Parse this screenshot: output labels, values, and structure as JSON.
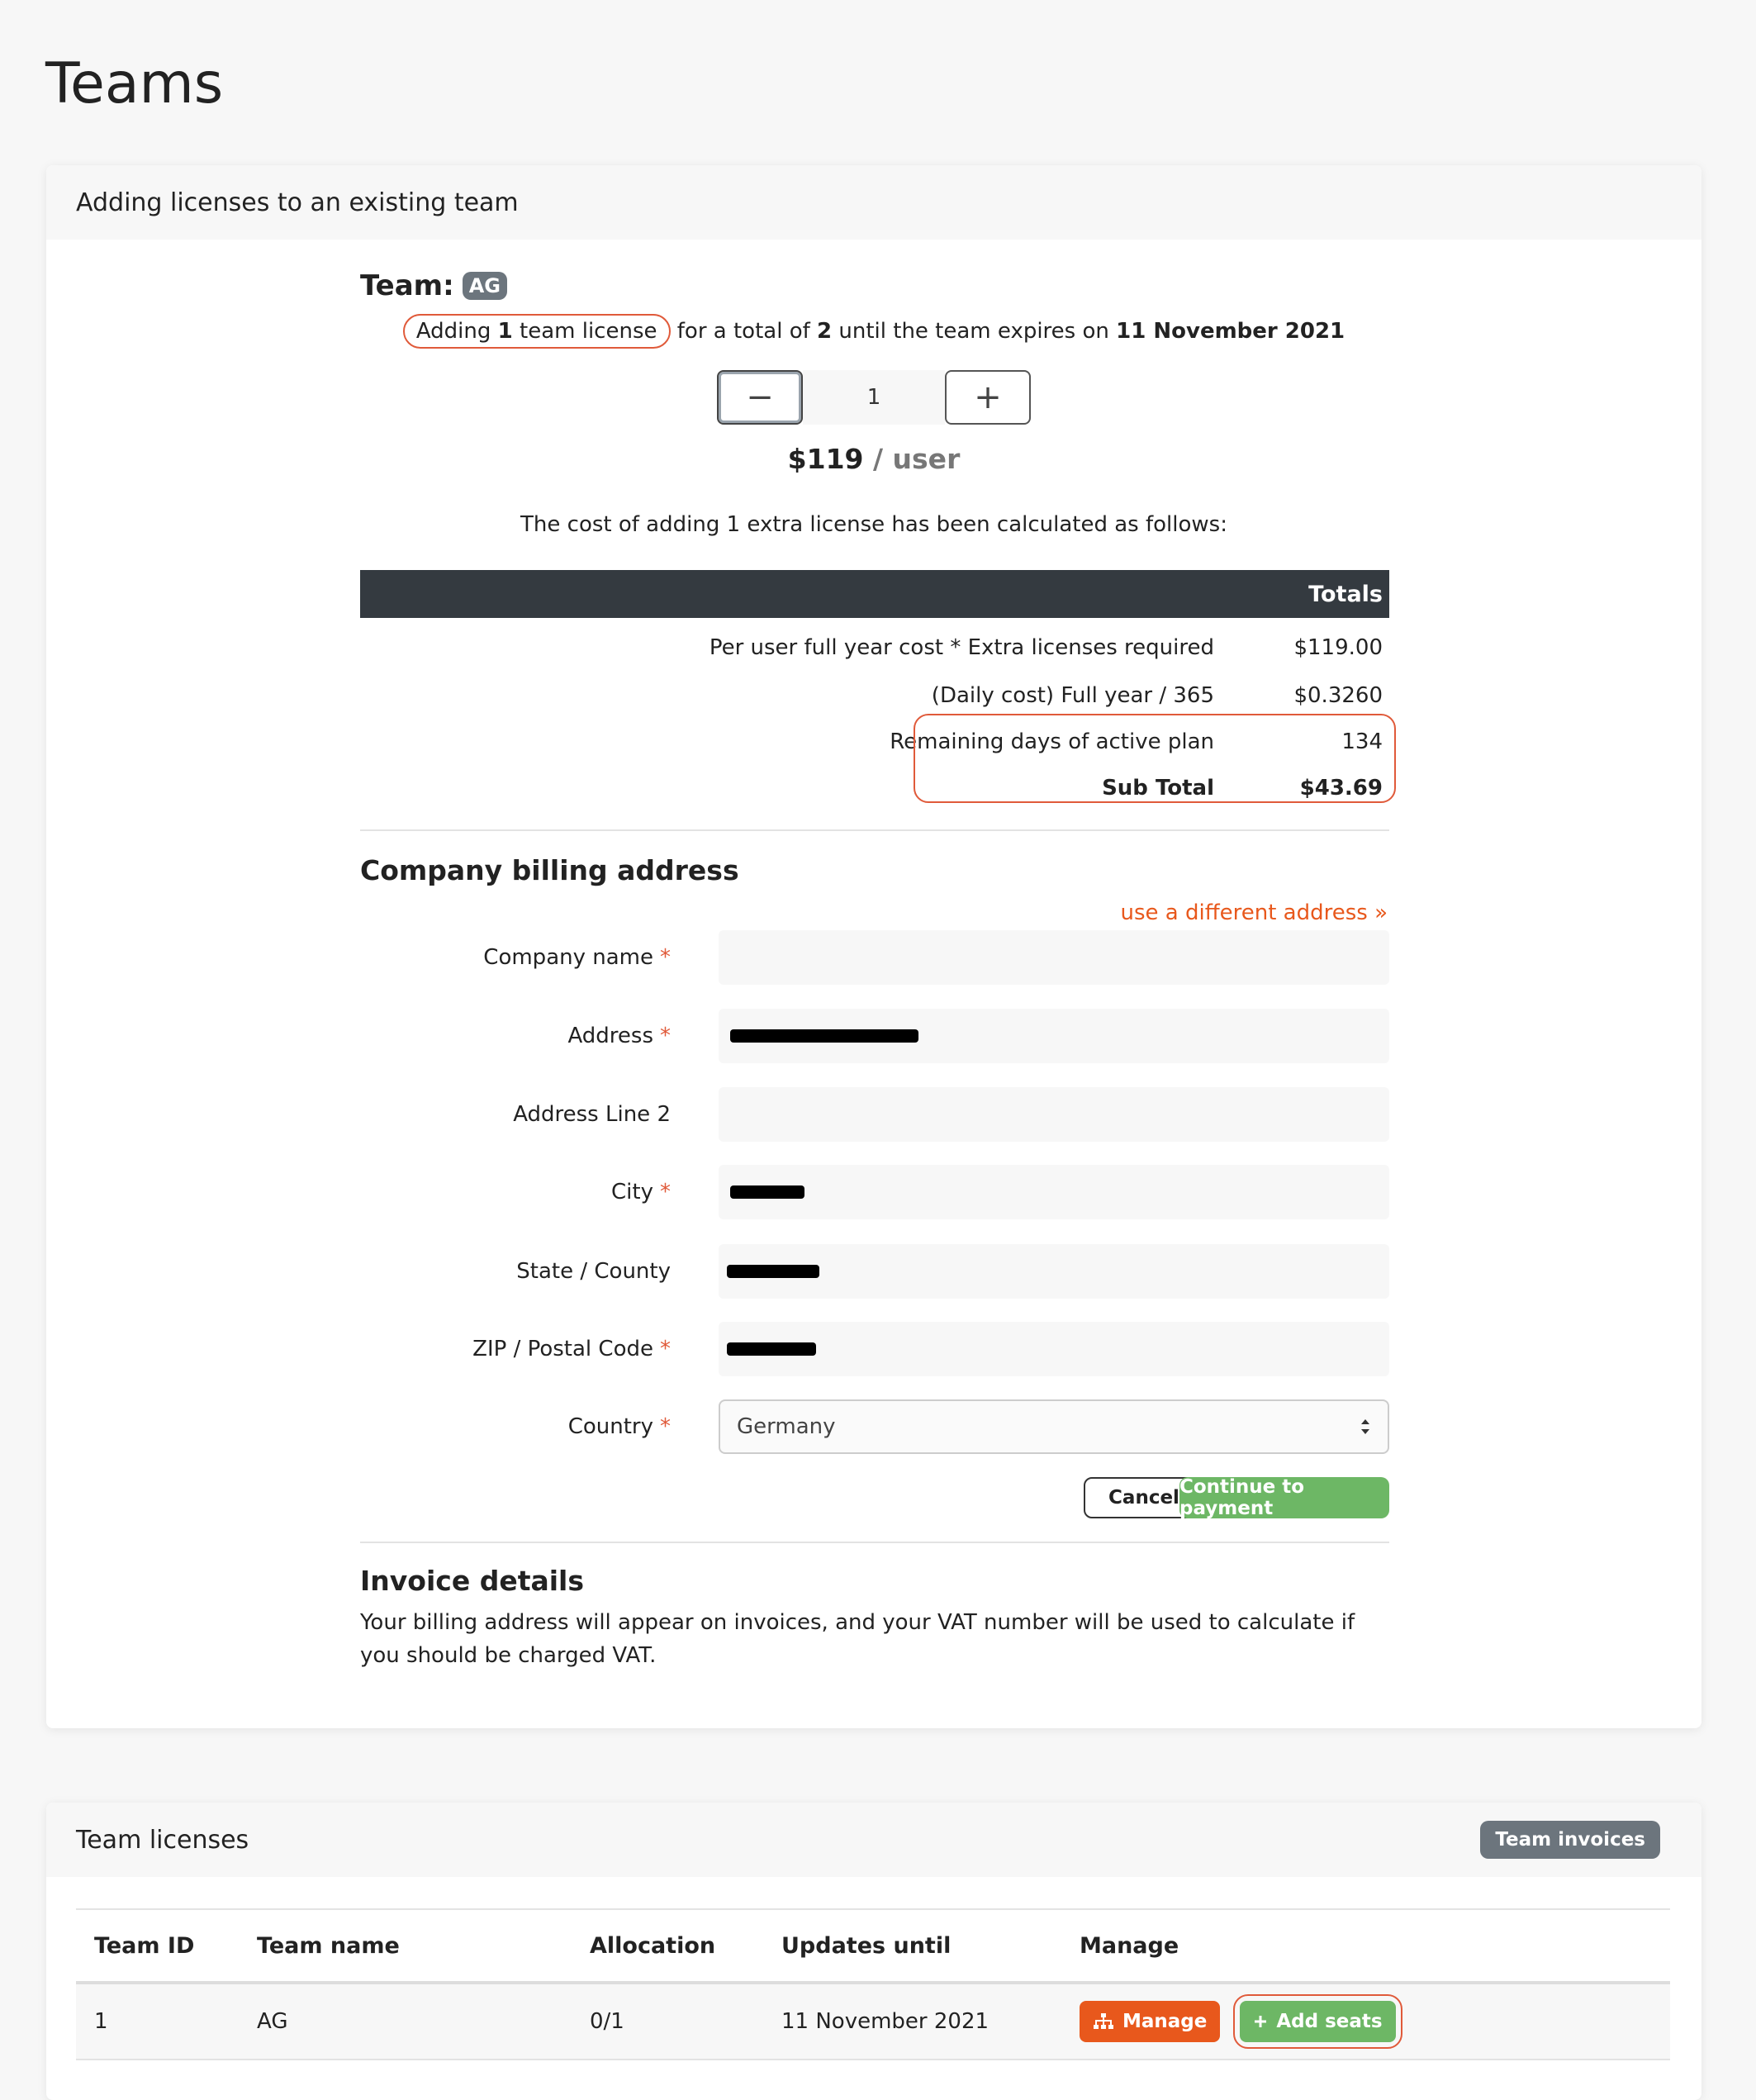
{
  "page": {
    "title": "Teams"
  },
  "adding": {
    "header": "Adding licenses to an existing team",
    "team_label": "Team:",
    "team_badge": "AG",
    "line_prefix": "Adding ",
    "line_count": "1",
    "line_unit": " team license",
    "line_mid": " for a total of ",
    "line_total": "2",
    "line_until": " until the team expires on ",
    "line_date": "11 November 2021",
    "stepper_minus": "−",
    "stepper_value": "1",
    "stepper_plus": "+",
    "price": "$119",
    "price_per": " / user",
    "calc_text": "The cost of adding 1 extra license has been calculated as follows:"
  },
  "totals": {
    "header": "Totals",
    "rows": [
      {
        "label": "Per user full year cost * Extra licenses required",
        "value": "$119.00"
      },
      {
        "label": "(Daily cost) Full year / 365",
        "value": "$0.3260"
      },
      {
        "label": "Remaining days of active plan",
        "value": "134"
      },
      {
        "label": "Sub Total",
        "value": "$43.69"
      }
    ]
  },
  "billing": {
    "title": "Company billing address",
    "different_link": "use a different address »",
    "fields": {
      "company_name": {
        "label": "Company name",
        "required": "*",
        "value": ""
      },
      "address": {
        "label": "Address",
        "required": "*"
      },
      "address2": {
        "label": "Address Line 2",
        "value": ""
      },
      "city": {
        "label": "City",
        "required": "*"
      },
      "state": {
        "label": "State / County"
      },
      "zip": {
        "label": "ZIP / Postal Code",
        "required": "*"
      },
      "country": {
        "label": "Country",
        "required": "*",
        "value": "Germany"
      }
    },
    "cancel": "Cancel",
    "continue": "Continue to payment"
  },
  "invoice": {
    "title": "Invoice details",
    "text": "Your billing address will appear on invoices, and your VAT number will be used to calculate if you should be charged VAT."
  },
  "licenses": {
    "header": "Team licenses",
    "invoices_button": "Team invoices",
    "columns": [
      "Team ID",
      "Team name",
      "Allocation",
      "Updates until",
      "Manage"
    ],
    "rows": [
      {
        "id": "1",
        "name": "AG",
        "allocation": "0/1",
        "updates_until": "11 November 2021",
        "manage": "Manage",
        "add": "Add seats"
      }
    ]
  },
  "colors": {
    "accent_orange": "#e8581c",
    "success_green": "#6db765",
    "highlight_red": "#e05a3a",
    "dark_header": "#343a40"
  }
}
